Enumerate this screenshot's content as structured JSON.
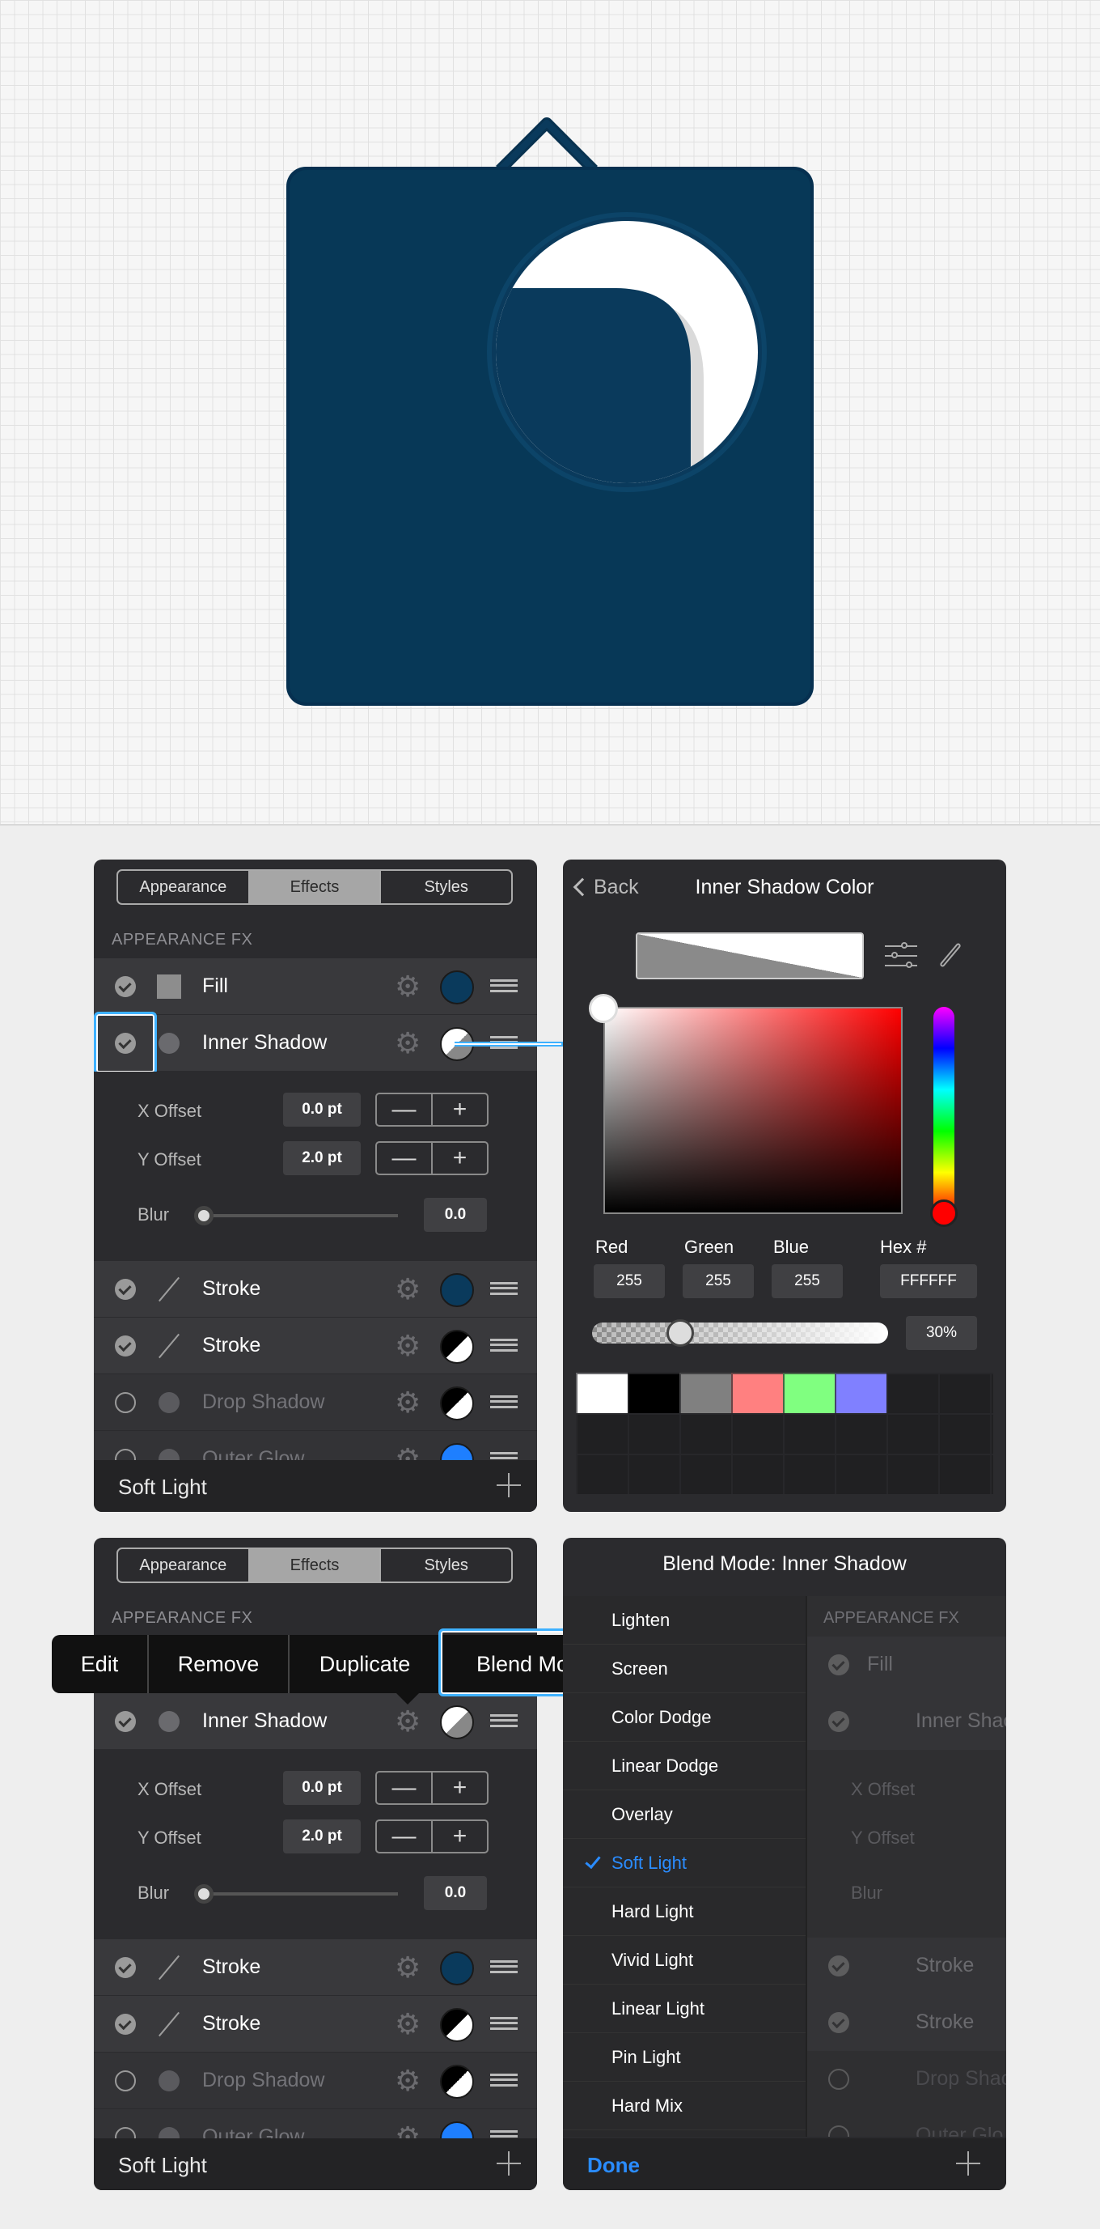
{
  "tabs": [
    "Appearance",
    "Effects",
    "Styles"
  ],
  "section_title": "APPEARANCE FX",
  "layers": [
    {
      "label": "Fill",
      "checked": true,
      "icon": "square",
      "swatch": "#0a3a5c"
    },
    {
      "label": "Inner Shadow",
      "checked": true,
      "icon": "dot",
      "swatch": "white-gray"
    },
    {
      "label": "Stroke",
      "checked": true,
      "icon": "line",
      "swatch": "#0a3a5c"
    },
    {
      "label": "Stroke",
      "checked": true,
      "icon": "line",
      "swatch": "black-white"
    },
    {
      "label": "Drop Shadow",
      "checked": false,
      "icon": "dot",
      "swatch": "black-white"
    },
    {
      "label": "Outer Glow",
      "checked": false,
      "icon": "dot",
      "swatch": "#1e7fff"
    }
  ],
  "inner_shadow": {
    "x_offset_label": "X Offset",
    "x_offset": "0.0 pt",
    "y_offset_label": "Y Offset",
    "y_offset": "2.0 pt",
    "blur_label": "Blur",
    "blur": "0.0",
    "minus": "—",
    "plus": "+"
  },
  "blend_footer": "Soft Light",
  "color_picker": {
    "back": "Back",
    "title": "Inner Shadow Color",
    "red_label": "Red",
    "red": "255",
    "green_label": "Green",
    "green": "255",
    "blue_label": "Blue",
    "blue": "255",
    "hex_label": "Hex #",
    "hex": "FFFFFF",
    "opacity": "30%",
    "presets": [
      "#ffffff",
      "#000000",
      "#808080",
      "#ff8080",
      "#80ff80",
      "#8080ff"
    ]
  },
  "context_menu": [
    "Edit",
    "Remove",
    "Duplicate",
    "Blend Mode"
  ],
  "blend_panel": {
    "title": "Blend Mode: Inner Shadow",
    "modes": [
      "Lighten",
      "Screen",
      "Color Dodge",
      "Linear Dodge",
      "Overlay",
      "Soft Light",
      "Hard Light",
      "Vivid Light",
      "Linear Light",
      "Pin Light",
      "Hard Mix"
    ],
    "selected": "Soft Light",
    "done": "Done",
    "visible_section": "APPEARANCE FX",
    "visible_layers": [
      "Fill",
      "Inner Shac",
      "Stroke",
      "Stroke",
      "Drop Shac",
      "Outer Glo"
    ],
    "visible_x": "X Offset",
    "visible_y": "Y Offset",
    "visible_blur": "Blur"
  },
  "colors": {
    "brand_navy": "#0a3a5c",
    "accent_blue": "#2a8cff",
    "highlight": "#3eb1ff",
    "panel": "#2b2b2e"
  }
}
